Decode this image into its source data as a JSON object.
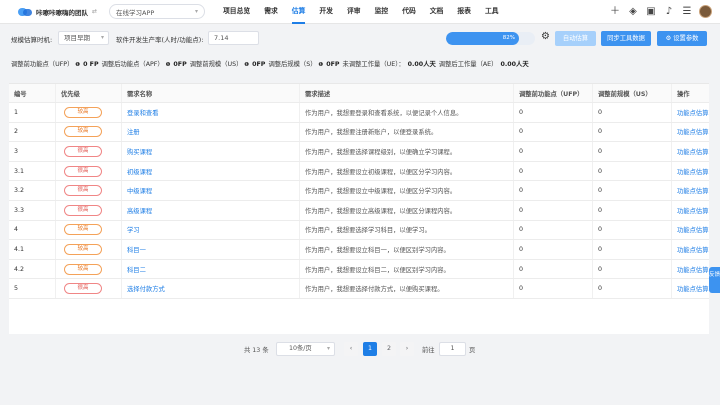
{
  "app": {
    "team_name": "咔嚓咔嚓嗨的团队",
    "project": "在线学习APP"
  },
  "nav": [
    "项目总览",
    "需求",
    "估算",
    "开发",
    "评审",
    "监控",
    "代码",
    "文档",
    "报表",
    "工具"
  ],
  "nav_active": "估算",
  "toolbar": {
    "timing_label": "规模估算时机:",
    "timing_value": "项目早期",
    "rate_label": "软件开发生产率(人时/功能点):",
    "rate_value": "7.14",
    "progress_percent": 82,
    "progress_text": "82%",
    "btn_auto": "自动估算",
    "btn_sync": "同步工具数据",
    "btn_params": "⚙ 设置参数"
  },
  "summary": [
    {
      "label": "调整前功能点（UFP）",
      "value": "0 FP"
    },
    {
      "label": "调整后功能点（APF）",
      "value": "0FP"
    },
    {
      "label": "调整前规模（US）",
      "value": "0FP"
    },
    {
      "label": "调整后规模（S）",
      "value": "0FP"
    },
    {
      "label": "未调整工作量（UE）：",
      "value": "0.00人天"
    },
    {
      "label": "调整后工作量（AE）",
      "value": "0.00人天"
    }
  ],
  "table": {
    "headers": [
      "编号",
      "优先级",
      "需求名称",
      "需求描述",
      "调整前功能点（UFP）",
      "调整前规模（US）",
      "操作"
    ],
    "rows": [
      {
        "id": "1",
        "priority": "较高",
        "level": "mid",
        "name": "登录和查看",
        "desc": "作为用户，我想要登录和查看系统，以便记录个人信息。",
        "ufp": "0",
        "us": "0",
        "action": "功能点估算"
      },
      {
        "id": "2",
        "priority": "较高",
        "level": "mid",
        "name": "注册",
        "desc": "作为用户，我想要注册新账户，以便登录系统。",
        "ufp": "0",
        "us": "0",
        "action": "功能点估算"
      },
      {
        "id": "3",
        "priority": "很高",
        "level": "high",
        "name": "购买课程",
        "desc": "作为用户，我想要选择课程级别，以便确立学习课程。",
        "ufp": "0",
        "us": "0",
        "action": "功能点估算"
      },
      {
        "id": "3.1",
        "priority": "很高",
        "level": "high",
        "name": "初级课程",
        "desc": "作为用户，我想要设立初级课程，以便区分学习内容。",
        "ufp": "0",
        "us": "0",
        "action": "功能点估算"
      },
      {
        "id": "3.2",
        "priority": "很高",
        "level": "high",
        "name": "中级课程",
        "desc": "作为用户，我想要设立中级课程，以便区分学习内容。",
        "ufp": "0",
        "us": "0",
        "action": "功能点估算"
      },
      {
        "id": "3.3",
        "priority": "很高",
        "level": "high",
        "name": "高级课程",
        "desc": "作为用户，我想要设立高级课程，以便区分课程内容。",
        "ufp": "0",
        "us": "0",
        "action": "功能点估算"
      },
      {
        "id": "4",
        "priority": "较高",
        "level": "mid",
        "name": "学习",
        "desc": "作为用户，我想要选择学习科目，以便学习。",
        "ufp": "0",
        "us": "0",
        "action": "功能点估算"
      },
      {
        "id": "4.1",
        "priority": "较高",
        "level": "mid",
        "name": "科目一",
        "desc": "作为用户，我想要设立科目一，以便区别学习内容。",
        "ufp": "0",
        "us": "0",
        "action": "功能点估算"
      },
      {
        "id": "4.2",
        "priority": "较高",
        "level": "mid",
        "name": "科目二",
        "desc": "作为用户，我想要设立科目二，以便区别学习内容。",
        "ufp": "0",
        "us": "0",
        "action": "功能点估算"
      },
      {
        "id": "5",
        "priority": "很高",
        "level": "high",
        "name": "选择付款方式",
        "desc": "作为用户，我想要选择付款方式，以便购买课程。",
        "ufp": "0",
        "us": "0",
        "action": "功能点估算"
      }
    ]
  },
  "pagination": {
    "total": "共 13 条",
    "page_size": "10条/页",
    "pages": [
      "1",
      "2"
    ],
    "current": "1",
    "goto_label": "前往",
    "goto_value": "1",
    "page_suffix": "页"
  },
  "feedback": "反馈"
}
